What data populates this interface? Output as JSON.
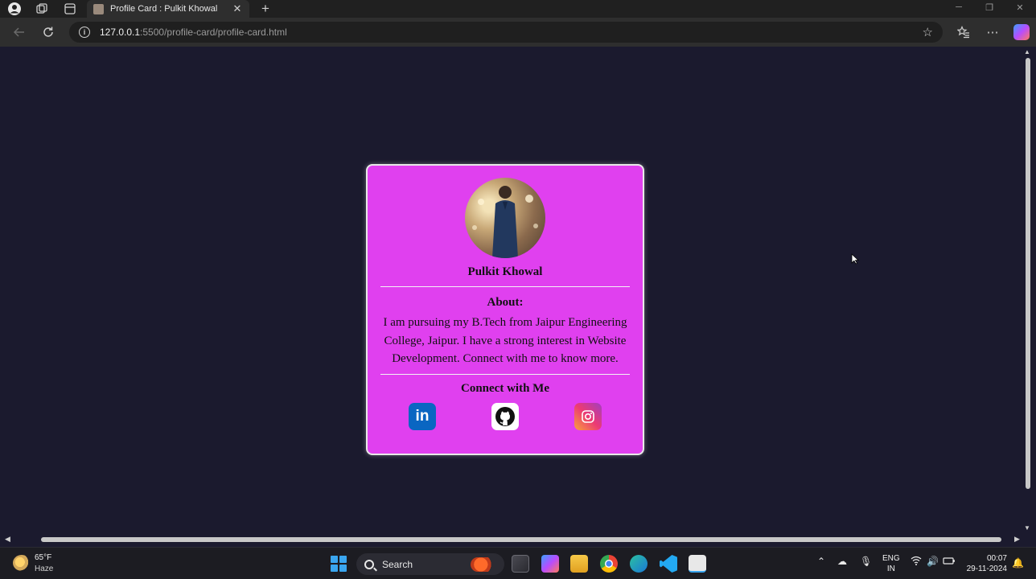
{
  "browser": {
    "tab_title": "Profile Card : Pulkit Khowal",
    "tab_close": "✕",
    "new_tab": "+",
    "url_host": "127.0.0.1",
    "url_path": ":5500/profile-card/profile-card.html"
  },
  "card": {
    "name": "Pulkit Khowal",
    "about_title": "About:",
    "about_text": "I am pursuing my B.Tech from Jaipur Engineering College, Jaipur. I have a strong interest in Website Development. Connect with me to know more.",
    "connect_title": "Connect with Me",
    "linkedin_label": "in",
    "background_color": "#e040ef",
    "page_background": "#1b1a2e"
  },
  "taskbar": {
    "weather_temp": "65°F",
    "weather_cond": "Haze",
    "search_label": "Search",
    "lang_1": "ENG",
    "lang_2": "IN",
    "time": "00:07",
    "date": "29-11-2024"
  }
}
